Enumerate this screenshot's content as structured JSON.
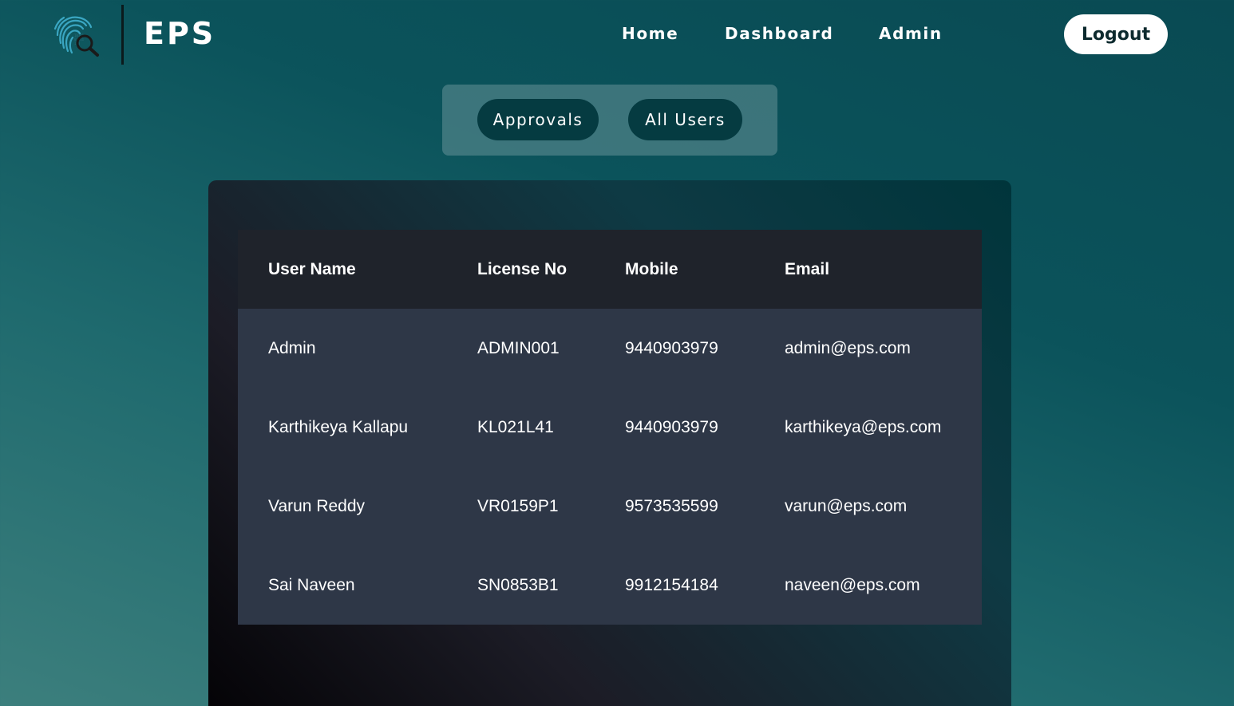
{
  "header": {
    "brand": "EPS",
    "nav": [
      {
        "label": "Home"
      },
      {
        "label": "Dashboard"
      },
      {
        "label": "Admin"
      }
    ],
    "logout_label": "Logout"
  },
  "tabs": [
    {
      "label": "Approvals"
    },
    {
      "label": "All Users"
    }
  ],
  "table": {
    "columns": [
      "User Name",
      "License No",
      "Mobile",
      "Email"
    ],
    "rows": [
      [
        "Admin",
        "ADMIN001",
        "9440903979",
        "admin@eps.com"
      ],
      [
        "Karthikeya Kallapu",
        "KL021L41",
        "9440903979",
        "karthikeya@eps.com"
      ],
      [
        "Varun Reddy",
        "VR0159P1",
        "9573535599",
        "varun@eps.com"
      ],
      [
        "Sai Naveen",
        "SN0853B1",
        "9912154184",
        "naveen@eps.com"
      ]
    ]
  },
  "colors": {
    "accent": "#053b41",
    "table_header": "#1f232b",
    "table_row": "#2e3747"
  },
  "icons": {
    "logo": "fingerprint-search-icon"
  }
}
